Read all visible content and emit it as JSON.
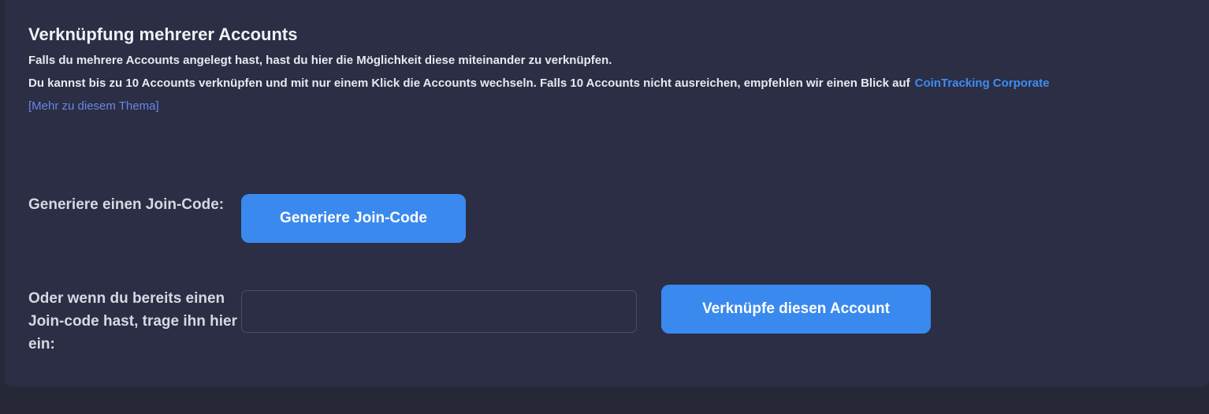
{
  "section": {
    "title": "Verknüpfung mehrerer Accounts",
    "description_line1": "Falls du mehrere Accounts angelegt hast, hast du hier die Möglichkeit diese miteinander zu verknüpfen.",
    "description_line2": "Du kannst bis zu 10 Accounts verknüpfen und mit nur einem Klick die Accounts wechseln. Falls 10 Accounts nicht ausreichen, empfehlen wir einen Blick auf",
    "corporate_link": "CoinTracking Corporate",
    "more_link": "[Mehr zu diesem Thema]"
  },
  "generate": {
    "label": "Generiere einen Join-Code:",
    "button_label": "Generiere Join-Code"
  },
  "join": {
    "label": "Oder wenn du bereits einen Join-code hast, trage ihn hier ein:",
    "input_value": "",
    "input_placeholder": "",
    "button_label": "Verknüpfe diesen Account"
  },
  "colors": {
    "background": "#262838",
    "panel": "#2b2e44",
    "accent": "#3a89ee",
    "link": "#3f8cf0"
  }
}
